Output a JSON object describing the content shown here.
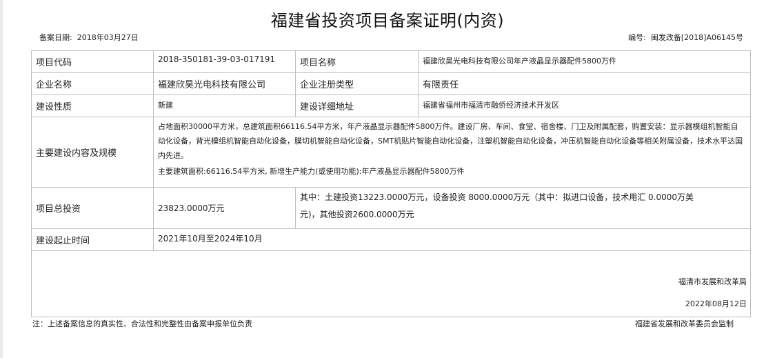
{
  "document": {
    "title": "福建省投资项目备案证明(内资)",
    "record_date_label": "备案日期:",
    "record_date": "2018年03月27日",
    "number_label": "编号:",
    "number": "闽发改备[2018]A06145号"
  },
  "table": {
    "project_code_label": "项目代码",
    "project_code": "2018-350181-39-03-017191",
    "project_name_label": "项目名称",
    "project_name": "福建欣昊光电科技有限公司年产液晶显示器配件5800万件",
    "company_label": "企业名称",
    "company": "福建欣昊光电科技有限公司",
    "reg_type_label": "企业注册类型",
    "reg_type": "有限责任",
    "nature_label": "建设性质",
    "nature": "新建",
    "address_label": "建设详细地址",
    "address": "福建省福州市福清市融侨经济技术开发区",
    "scope_label": "主要建设内容及规模",
    "scope_text": "占地面积30000平方米，总建筑面积66116.54平方米，年产液晶显示器配件5800万件。建设厂房、车间、食堂、宿舍楼、门卫及附属配套，购置安装：显示器模组机智能自动化设备，背光模组机智能自动化设备，膜切机智能自动化设备，SMT机贴片智能自动化设备，注塑机智能自动化设备，冲压机智能自动化设备等相关附属设备，技术水平达国内先进。",
    "scope_summary": "主要建筑面积:66116.54平方米, 新增生产能力(或使用功能):年产液晶显示器配件5800万件",
    "investment_label": "项目总投资",
    "investment_total": "23823.0000万元",
    "investment_detail": "其中：土建投资13223.0000万元，设备投资 8000.0000万元（其中：拟进口设备，技术用汇 0.0000万美元)，其他投资2600.0000万元",
    "period_label": "建设起止时间",
    "period": "2021年10月至2024年10月",
    "office": "福清市发展和改革局",
    "sign_date": "2022年08月12日"
  },
  "footer": {
    "note": "注：上述备案信息的真实性、合法性和完整性由备案申报单位负责",
    "supervisor": "福建省发展和改革委员会监制"
  }
}
